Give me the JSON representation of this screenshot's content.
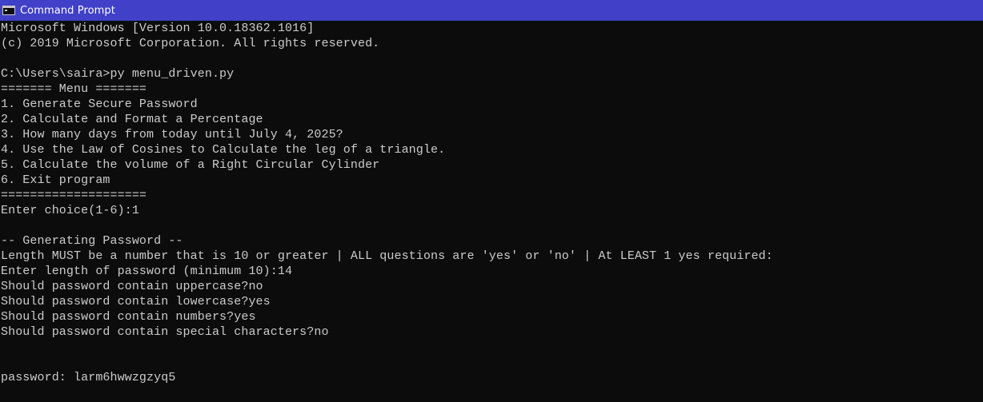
{
  "window": {
    "title": "Command Prompt",
    "icon": "cmd-icon"
  },
  "console": {
    "lines": [
      "Microsoft Windows [Version 10.0.18362.1016]",
      "(c) 2019 Microsoft Corporation. All rights reserved.",
      "",
      "C:\\Users\\saira>py menu_driven.py",
      "======= Menu =======",
      "1. Generate Secure Password",
      "2. Calculate and Format a Percentage",
      "3. How many days from today until July 4, 2025?",
      "4. Use the Law of Cosines to Calculate the leg of a triangle.",
      "5. Calculate the volume of a Right Circular Cylinder",
      "6. Exit program",
      "====================",
      "Enter choice(1-6):1",
      "",
      "-- Generating Password --",
      "Length MUST be a number that is 10 or greater | ALL questions are 'yes' or 'no' | At LEAST 1 yes required:",
      "Enter length of password (minimum 10):14",
      "Should password contain uppercase?no",
      "Should password contain lowercase?yes",
      "Should password contain numbers?yes",
      "Should password contain special characters?no",
      "",
      "",
      "password: larm6hwwzgzyq5"
    ]
  }
}
